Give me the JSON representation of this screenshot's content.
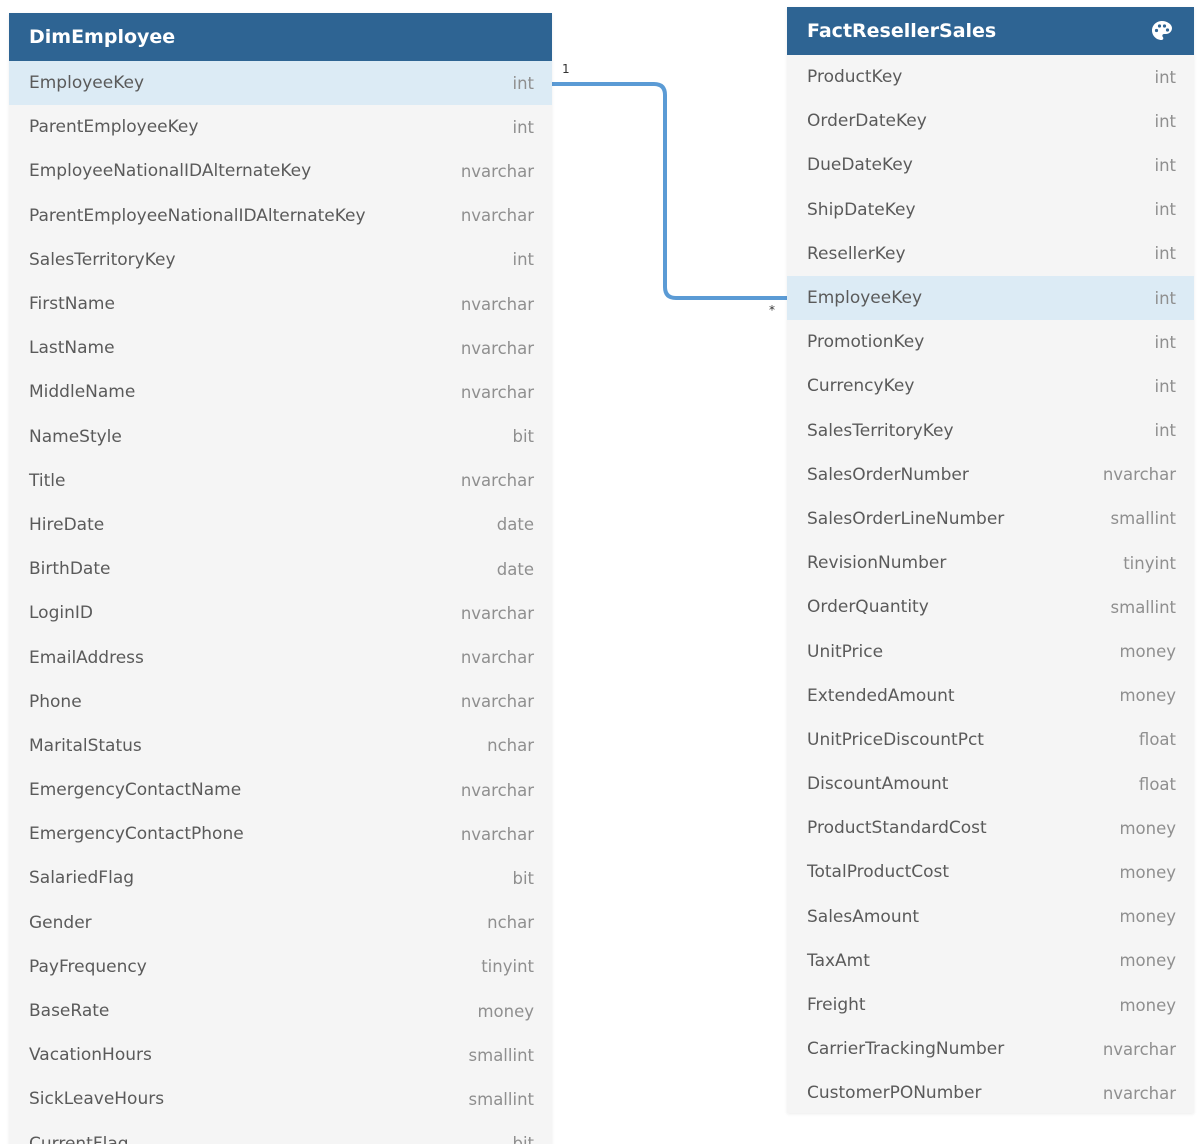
{
  "tables": {
    "left": {
      "name": "DimEmployee",
      "columns": [
        {
          "name": "EmployeeKey",
          "type": "int",
          "highlighted": true
        },
        {
          "name": "ParentEmployeeKey",
          "type": "int"
        },
        {
          "name": "EmployeeNationalIDAlternateKey",
          "type": "nvarchar"
        },
        {
          "name": "ParentEmployeeNationalIDAlternateKey",
          "type": "nvarchar"
        },
        {
          "name": "SalesTerritoryKey",
          "type": "int"
        },
        {
          "name": "FirstName",
          "type": "nvarchar"
        },
        {
          "name": "LastName",
          "type": "nvarchar"
        },
        {
          "name": "MiddleName",
          "type": "nvarchar"
        },
        {
          "name": "NameStyle",
          "type": "bit"
        },
        {
          "name": "Title",
          "type": "nvarchar"
        },
        {
          "name": "HireDate",
          "type": "date"
        },
        {
          "name": "BirthDate",
          "type": "date"
        },
        {
          "name": "LoginID",
          "type": "nvarchar"
        },
        {
          "name": "EmailAddress",
          "type": "nvarchar"
        },
        {
          "name": "Phone",
          "type": "nvarchar"
        },
        {
          "name": "MaritalStatus",
          "type": "nchar"
        },
        {
          "name": "EmergencyContactName",
          "type": "nvarchar"
        },
        {
          "name": "EmergencyContactPhone",
          "type": "nvarchar"
        },
        {
          "name": "SalariedFlag",
          "type": "bit"
        },
        {
          "name": "Gender",
          "type": "nchar"
        },
        {
          "name": "PayFrequency",
          "type": "tinyint"
        },
        {
          "name": "BaseRate",
          "type": "money"
        },
        {
          "name": "VacationHours",
          "type": "smallint"
        },
        {
          "name": "SickLeaveHours",
          "type": "smallint"
        },
        {
          "name": "CurrentFlag",
          "type": "bit"
        }
      ]
    },
    "right": {
      "name": "FactResellerSales",
      "header_icon": "palette-icon",
      "columns": [
        {
          "name": "ProductKey",
          "type": "int"
        },
        {
          "name": "OrderDateKey",
          "type": "int"
        },
        {
          "name": "DueDateKey",
          "type": "int"
        },
        {
          "name": "ShipDateKey",
          "type": "int"
        },
        {
          "name": "ResellerKey",
          "type": "int"
        },
        {
          "name": "EmployeeKey",
          "type": "int",
          "highlighted": true
        },
        {
          "name": "PromotionKey",
          "type": "int"
        },
        {
          "name": "CurrencyKey",
          "type": "int"
        },
        {
          "name": "SalesTerritoryKey",
          "type": "int"
        },
        {
          "name": "SalesOrderNumber",
          "type": "nvarchar"
        },
        {
          "name": "SalesOrderLineNumber",
          "type": "smallint"
        },
        {
          "name": "RevisionNumber",
          "type": "tinyint"
        },
        {
          "name": "OrderQuantity",
          "type": "smallint"
        },
        {
          "name": "UnitPrice",
          "type": "money"
        },
        {
          "name": "ExtendedAmount",
          "type": "money"
        },
        {
          "name": "UnitPriceDiscountPct",
          "type": "float"
        },
        {
          "name": "DiscountAmount",
          "type": "float"
        },
        {
          "name": "ProductStandardCost",
          "type": "money"
        },
        {
          "name": "TotalProductCost",
          "type": "money"
        },
        {
          "name": "SalesAmount",
          "type": "money"
        },
        {
          "name": "TaxAmt",
          "type": "money"
        },
        {
          "name": "Freight",
          "type": "money"
        },
        {
          "name": "CarrierTrackingNumber",
          "type": "nvarchar"
        },
        {
          "name": "CustomerPONumber",
          "type": "nvarchar"
        }
      ]
    }
  },
  "relationship": {
    "from": "DimEmployee.EmployeeKey",
    "to": "FactResellerSales.EmployeeKey",
    "from_cardinality": "1",
    "to_cardinality": "*"
  },
  "colors": {
    "header": "#2e6493",
    "highlight_row": "#dcebf5",
    "connector": "#5b9bd5",
    "table_bg": "#f5f5f5"
  }
}
